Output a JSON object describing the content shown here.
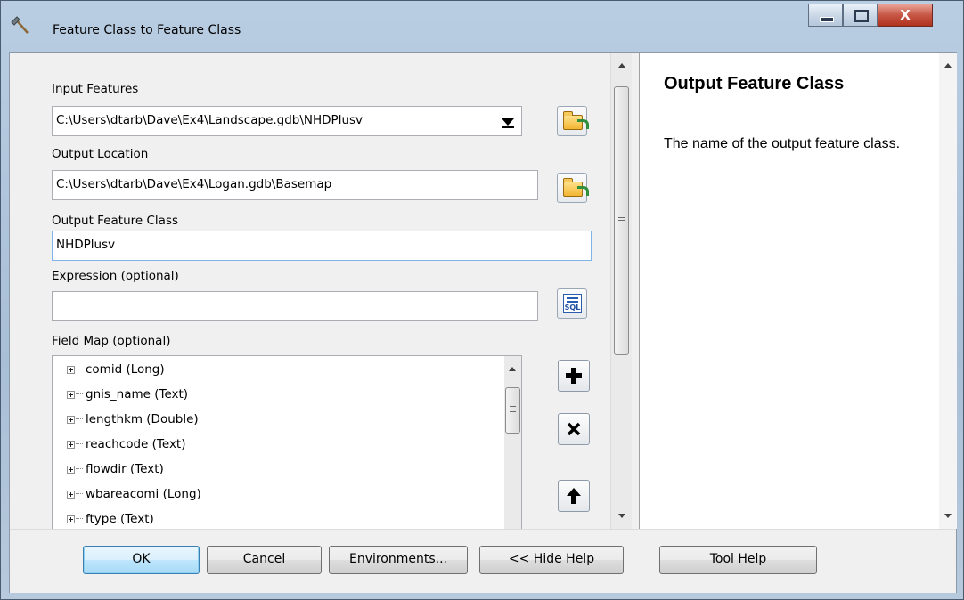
{
  "window": {
    "title": "Feature Class to Feature Class",
    "controls": {
      "close_label": "X"
    }
  },
  "form": {
    "input_features": {
      "label": "Input Features",
      "value": "C:\\Users\\dtarb\\Dave\\Ex4\\Landscape.gdb\\NHDPlusv"
    },
    "output_location": {
      "label": "Output Location",
      "value": "C:\\Users\\dtarb\\Dave\\Ex4\\Logan.gdb\\Basemap"
    },
    "output_feature_class": {
      "label": "Output Feature Class",
      "value": "NHDPlusv"
    },
    "expression": {
      "label": "Expression (optional)",
      "value": "",
      "sql_icon_label": "SQL"
    },
    "field_map": {
      "label": "Field Map (optional)",
      "fields": [
        "comid (Long)",
        "gnis_name (Text)",
        "lengthkm (Double)",
        "reachcode (Text)",
        "flowdir (Text)",
        "wbareacomi (Long)",
        "ftype (Text)"
      ]
    }
  },
  "help": {
    "title": "Output Feature Class",
    "body": "The name of the output feature class."
  },
  "buttons": {
    "ok": "OK",
    "cancel": "Cancel",
    "environments": "Environments...",
    "hide_help": "<< Hide Help",
    "tool_help": "Tool Help"
  }
}
